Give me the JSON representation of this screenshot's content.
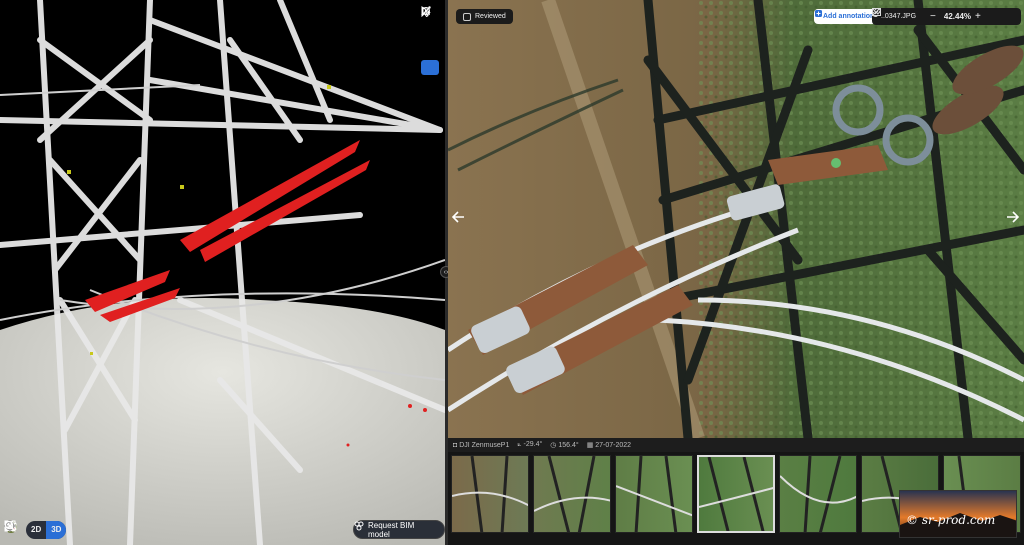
{
  "left_toolbar": {
    "tools": [
      {
        "icon": "cursor-icon"
      },
      {
        "icon": "measure-line-icon"
      },
      {
        "icon": "crop-icon"
      },
      {
        "icon": "target-icon",
        "active": true
      }
    ]
  },
  "bottom_bar": {
    "mode_2d": "2D",
    "mode_3d": "3D",
    "active_mode": "3D",
    "bim_label": "Request BIM model",
    "icons": [
      "plant-icon",
      "flag-icon",
      "gear-icon",
      "book-icon",
      "camera-icon",
      "crosshair-icon",
      "fit-screen-icon",
      "zoom-in-icon",
      "zoom-out-icon"
    ]
  },
  "photo_viewer": {
    "reviewed_label": "Reviewed",
    "add_annotation_label": "Add annotation",
    "filename": "..0347.JPG",
    "zoom": "42.44%",
    "accent": "#2b6fd6"
  },
  "meta": {
    "camera": "DJI ZenmuseP1",
    "pitch": "-29.4°",
    "heading": "156.4°",
    "date": "27-07-2022"
  },
  "watermark": {
    "text": "© sr-prod.com"
  }
}
